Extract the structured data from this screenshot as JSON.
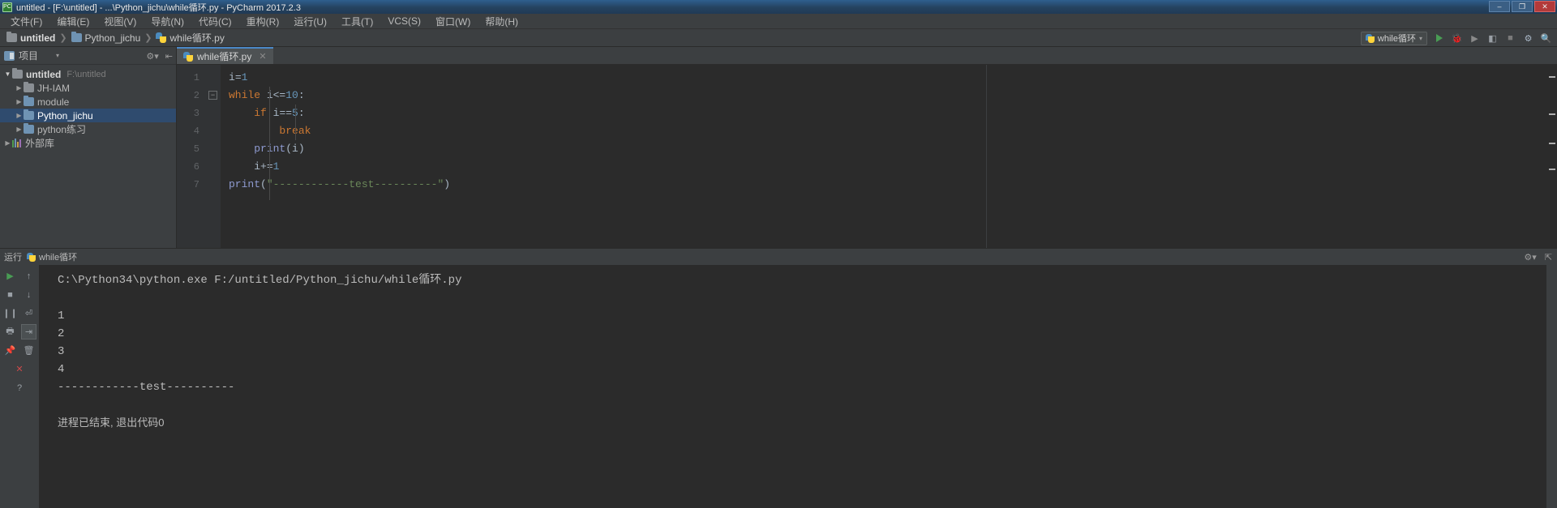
{
  "window": {
    "title": "untitled - [F:\\untitled] - ...\\Python_jichu\\while循环.py - PyCharm 2017.2.3",
    "app_icon": "pycharm-icon",
    "buttons": {
      "minimize": "–",
      "maximize": "❐",
      "close": "✕"
    }
  },
  "menubar": [
    {
      "label": "文件(F)"
    },
    {
      "label": "编辑(E)"
    },
    {
      "label": "视图(V)"
    },
    {
      "label": "导航(N)"
    },
    {
      "label": "代码(C)"
    },
    {
      "label": "重构(R)"
    },
    {
      "label": "运行(U)"
    },
    {
      "label": "工具(T)"
    },
    {
      "label": "VCS(S)"
    },
    {
      "label": "窗口(W)"
    },
    {
      "label": "帮助(H)"
    }
  ],
  "navbar": {
    "crumbs": [
      {
        "label": "untitled",
        "icon": "folder-icon"
      },
      {
        "label": "Python_jichu",
        "icon": "folder-icon"
      },
      {
        "label": "while循环.py",
        "icon": "python-file-icon"
      }
    ],
    "separator": "❯",
    "run_config": {
      "label": "while循环",
      "icon": "python-file-icon",
      "caret": "▾"
    },
    "tools": [
      {
        "name": "run-button",
        "glyph": "▶"
      },
      {
        "name": "debug-button",
        "glyph": "🐞"
      },
      {
        "name": "coverage-button",
        "glyph": "▶"
      },
      {
        "name": "profile-button",
        "glyph": "◧"
      },
      {
        "name": "stop-button",
        "glyph": "■"
      },
      {
        "name": "settings-button",
        "glyph": "⚙"
      },
      {
        "name": "search-button",
        "glyph": "🔍"
      }
    ]
  },
  "project_panel": {
    "title": "项目",
    "caret": "▾",
    "icon": "project-icon",
    "header_tools": [
      {
        "name": "settings-icon",
        "glyph": "⚙▾"
      },
      {
        "name": "collapse-icon",
        "glyph": "⇤"
      }
    ],
    "tree": [
      {
        "label": "untitled",
        "path": "F:\\untitled",
        "arrow": "▼",
        "depth": 0,
        "icon": "folder-icon",
        "bold": true,
        "selected": false
      },
      {
        "label": "JH-IAM",
        "path": "",
        "arrow": "▶",
        "depth": 1,
        "icon": "folder-icon",
        "bold": false,
        "selected": false
      },
      {
        "label": "module",
        "path": "",
        "arrow": "▶",
        "depth": 1,
        "icon": "module-folder-icon",
        "bold": false,
        "selected": false
      },
      {
        "label": "Python_jichu",
        "path": "",
        "arrow": "▶",
        "depth": 1,
        "icon": "module-folder-icon",
        "bold": false,
        "selected": true
      },
      {
        "label": "python练习",
        "path": "",
        "arrow": "▶",
        "depth": 1,
        "icon": "module-folder-icon",
        "bold": false,
        "selected": false
      },
      {
        "label": "外部库",
        "path": "",
        "arrow": "▶",
        "depth": 0,
        "icon": "library-icon",
        "bold": false,
        "selected": false
      }
    ]
  },
  "editor": {
    "tab": {
      "label": "while循环.py",
      "icon": "python-file-icon",
      "close": "✕"
    },
    "lines": [
      {
        "no": "1",
        "html": "i=1"
      },
      {
        "no": "2",
        "html": "while i<=10:"
      },
      {
        "no": "3",
        "html": "    if i==5:"
      },
      {
        "no": "4",
        "html": "        break"
      },
      {
        "no": "5",
        "html": "    print(i)"
      },
      {
        "no": "6",
        "html": "    i+=1"
      },
      {
        "no": "7",
        "html": "print(\"------------test----------\")"
      }
    ]
  },
  "console": {
    "header": {
      "label": "运行",
      "tab_name": "while循环",
      "icon": "python-file-icon"
    },
    "header_tools": [
      {
        "name": "settings-icon",
        "glyph": "⚙▾"
      },
      {
        "name": "hide-icon",
        "glyph": "⇱"
      }
    ],
    "tools": [
      {
        "name": "rerun-button",
        "glyph": "▶"
      },
      {
        "name": "scroll-up-button",
        "glyph": "↑"
      },
      {
        "name": "stop-button",
        "glyph": "■"
      },
      {
        "name": "scroll-down-button",
        "glyph": "↓"
      },
      {
        "name": "pause-button",
        "glyph": "❙❙"
      },
      {
        "name": "soft-wrap-button",
        "glyph": "⏎"
      },
      {
        "name": "print-button",
        "glyph": "🖶"
      },
      {
        "name": "scroll-to-end-button",
        "glyph": "⇥"
      },
      {
        "name": "trash-button",
        "glyph": "🗑"
      },
      {
        "name": "pin-button",
        "glyph": "📌"
      },
      {
        "name": "clear-all-button",
        "glyph": "✕"
      },
      {
        "name": "help-button",
        "glyph": "?"
      }
    ],
    "output": [
      "C:\\Python34\\python.exe F:/untitled/Python_jichu/while循环.py",
      "",
      "1",
      "2",
      "3",
      "4",
      "------------test----------",
      "",
      "进程已结束, 退出代码0"
    ]
  },
  "colors": {
    "accent": "#4a88c7",
    "selection": "#2f4b6e",
    "keyword": "#cc7832",
    "number": "#6897bb",
    "string": "#6a8759",
    "function": "#8f9bd1",
    "editor_bg": "#2b2b2b",
    "chrome_bg": "#3c3f41",
    "titlebar_bg": "#25425f"
  }
}
